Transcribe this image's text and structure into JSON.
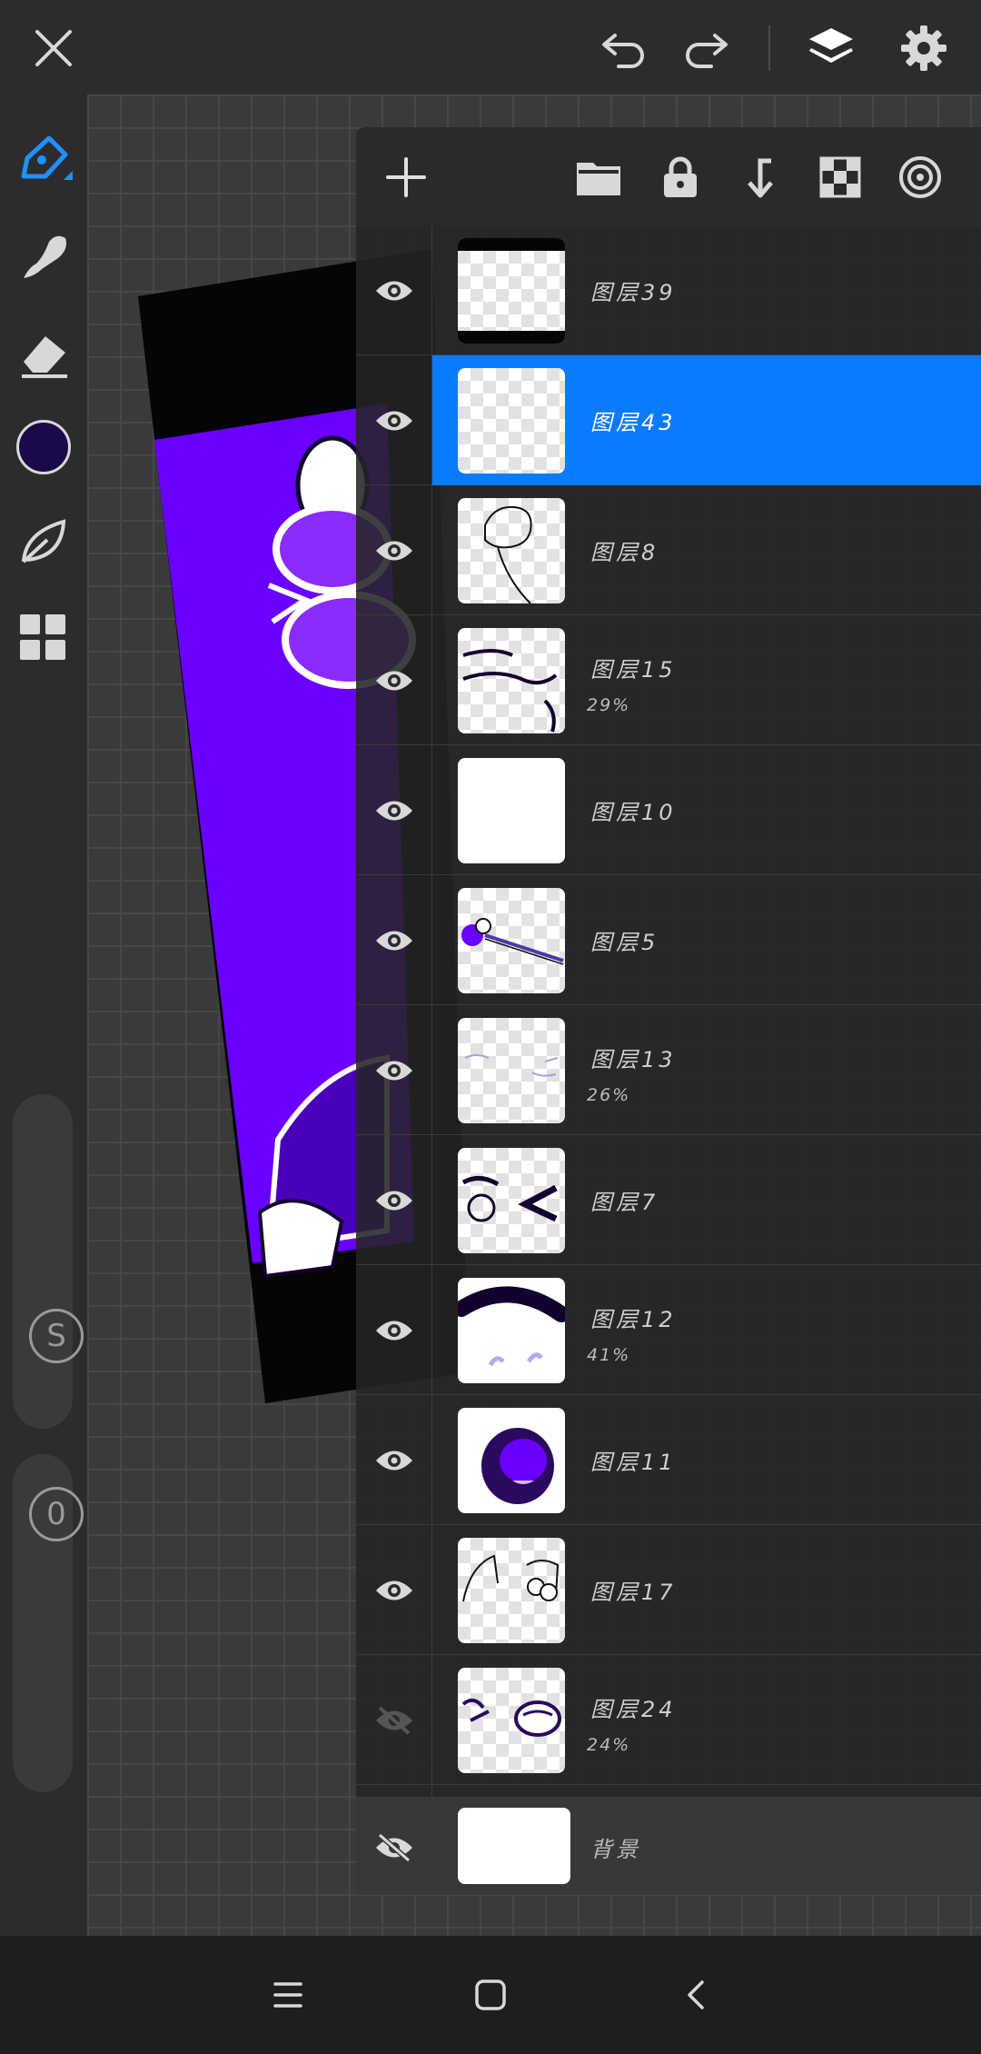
{
  "top_bar": {
    "icons": [
      "close-icon",
      "undo-icon",
      "redo-icon",
      "layers-icon",
      "settings-icon"
    ]
  },
  "sidebar": {
    "tools": [
      "pen-tool-icon",
      "smudge-brush-icon",
      "eraser-icon",
      "color-swatch",
      "leaf-brush-icon",
      "grid-menu-icon"
    ],
    "current_color": "#1b0a4a",
    "size_slider_label": "S",
    "opacity_slider_label": "0"
  },
  "layers_panel": {
    "toolbar_icons": [
      "add-layer-icon",
      "folder-icon",
      "lock-icon",
      "merge-down-icon",
      "transparency-icon",
      "clipping-icon"
    ],
    "layers": [
      {
        "name": "图层39",
        "opacity": "",
        "visible": true,
        "selected": false
      },
      {
        "name": "图层43",
        "opacity": "",
        "visible": true,
        "selected": true
      },
      {
        "name": "图层8",
        "opacity": "",
        "visible": true,
        "selected": false
      },
      {
        "name": "图层15",
        "opacity": "29%",
        "visible": true,
        "selected": false
      },
      {
        "name": "图层10",
        "opacity": "",
        "visible": true,
        "selected": false
      },
      {
        "name": "图层5",
        "opacity": "",
        "visible": true,
        "selected": false
      },
      {
        "name": "图层13",
        "opacity": "26%",
        "visible": true,
        "selected": false
      },
      {
        "name": "图层7",
        "opacity": "",
        "visible": true,
        "selected": false
      },
      {
        "name": "图层12",
        "opacity": "41%",
        "visible": true,
        "selected": false
      },
      {
        "name": "图层11",
        "opacity": "",
        "visible": true,
        "selected": false
      },
      {
        "name": "图层17",
        "opacity": "",
        "visible": true,
        "selected": false
      },
      {
        "name": "图层24",
        "opacity": "24%",
        "visible": false,
        "selected": false
      }
    ],
    "background_layer": {
      "name": "背景",
      "visible": false
    }
  },
  "colors": {
    "accent": "#0a7bff",
    "artwork_purple": "#6a00ff"
  },
  "nav_bar": {
    "icons": [
      "recent-apps-icon",
      "home-icon",
      "back-icon"
    ]
  }
}
